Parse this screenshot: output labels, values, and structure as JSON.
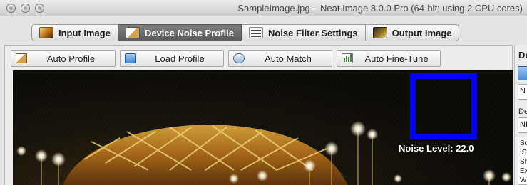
{
  "window": {
    "title": "SampleImage.jpg – Neat Image 8.0.0 Pro (64-bit; using 2 CPU cores)"
  },
  "tabs": [
    {
      "label": "Input Image",
      "active": false,
      "icon": "input-image-icon"
    },
    {
      "label": "Device Noise Profile",
      "active": true,
      "icon": "device-noise-profile-icon"
    },
    {
      "label": "Noise Filter Settings",
      "active": false,
      "icon": "noise-filter-settings-icon"
    },
    {
      "label": "Output Image",
      "active": false,
      "icon": "output-image-icon"
    }
  ],
  "toolbar": {
    "auto_profile": "Auto Profile",
    "load_profile": "Load Profile",
    "auto_match": "Auto Match",
    "auto_fine_tune": "Auto Fine-Tune"
  },
  "preview": {
    "noise_level_label": "Noise Level: 22.0",
    "selection_color": "#0000ff"
  },
  "right_panel": {
    "header": "De",
    "field1": "N",
    "label2": "De",
    "field2": "NI",
    "info_lines": [
      "So",
      "IS",
      "Sh",
      "Ex",
      "W"
    ]
  },
  "colors": {
    "active_tab": "#666666",
    "selection_box": "#0000ff"
  }
}
